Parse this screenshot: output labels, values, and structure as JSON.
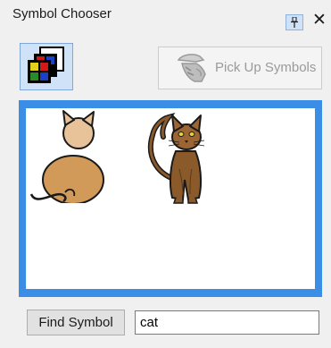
{
  "window": {
    "title": "Symbol Chooser",
    "pin_icon": "pin-icon",
    "close_label": "✕"
  },
  "toolbar": {
    "palette_icon": "color-palette-icon",
    "pickup_label": "Pick Up Symbols",
    "pickup_icon": "hand-pickup-icon"
  },
  "results": {
    "symbols": [
      {
        "name": "cat-simple-symbol"
      },
      {
        "name": "cat-realistic-symbol"
      }
    ],
    "selection_color": "#3a8ee6"
  },
  "search": {
    "button_label": "Find Symbol",
    "value": "cat"
  }
}
